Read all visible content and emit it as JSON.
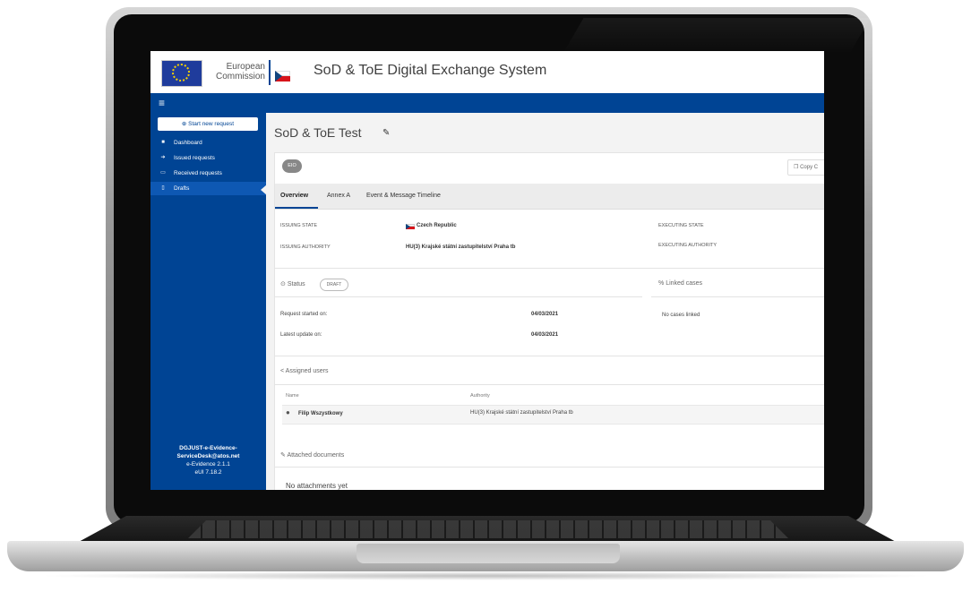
{
  "header": {
    "logo_text_line1": "European",
    "logo_text_line2": "Commission",
    "app_title": "SoD & ToE Digital Exchange System"
  },
  "topbar": {
    "menu_icon": "≡"
  },
  "sidebar": {
    "start_button": "Start new request",
    "start_icon": "⊕",
    "items": [
      {
        "icon": "■",
        "label": "Dashboard"
      },
      {
        "icon": "➔",
        "label": "Issued requests"
      },
      {
        "icon": "▭",
        "label": "Received requests"
      },
      {
        "icon": "▯",
        "label": "Drafts"
      }
    ],
    "footer": {
      "email_line1": "DGJUST-e-Evidence-",
      "email_line2": "ServiceDesk@atos.net",
      "version": "e-Evidence 2.1.1",
      "eui": "eUI 7.18.2"
    }
  },
  "page": {
    "title": "SoD & ToE Test",
    "edit_icon": "✎",
    "badge": "EIO",
    "copy_button": "Copy C",
    "copy_icon": "❐"
  },
  "tabs": [
    "Overview",
    "Annex A",
    "Event & Message Timeline"
  ],
  "overview": {
    "issuing_state_label": "ISSUING STATE",
    "issuing_state_value": "Czech Republic",
    "executing_state_label": "EXECUTING STATE",
    "issuing_authority_label": "ISSUING AUTHORITY",
    "issuing_authority_value": "HU(3) Krajské státní zastupitelství Praha tb",
    "executing_authority_label": "EXECUTING AUTHORITY"
  },
  "status": {
    "icon": "⊙",
    "title": "Status",
    "badge": "DRAFT",
    "started_label": "Request started on:",
    "started_value": "04/03/2021",
    "updated_label": "Latest update on:",
    "updated_value": "04/03/2021"
  },
  "linked": {
    "icon": "%",
    "title": "Linked cases",
    "empty": "No cases linked"
  },
  "assigned": {
    "icon": "<",
    "title": "Assigned users",
    "col_name": "Name",
    "col_authority": "Authority",
    "rows": [
      {
        "name": "Filip Wszystkowy",
        "authority": "HU(3) Krajské státní zastupitelství Praha tb"
      }
    ]
  },
  "attachments": {
    "icon": "✎",
    "title": "Attached documents",
    "empty": "No attachments yet"
  }
}
